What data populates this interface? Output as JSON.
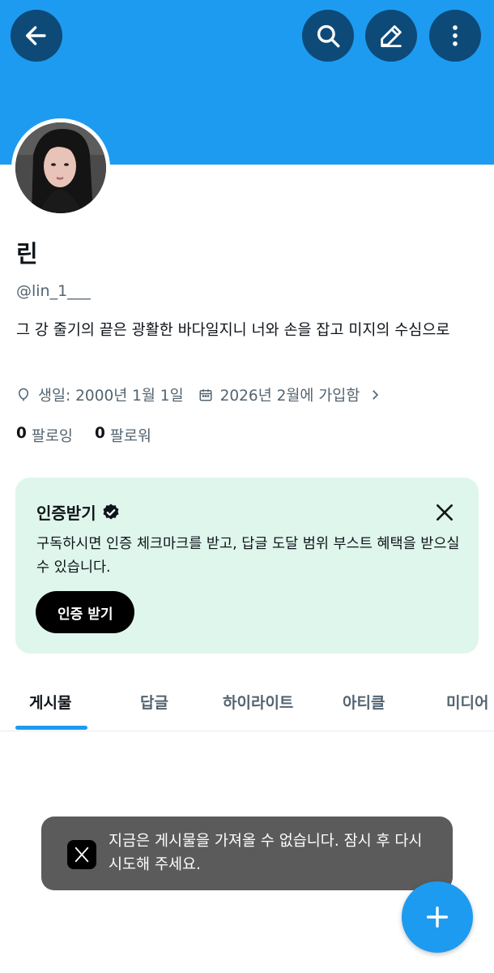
{
  "header": {
    "back_icon": "arrow-left-icon",
    "search_icon": "search-icon",
    "edit_icon": "pencil-icon",
    "more_icon": "more-vertical-icon",
    "banner_color": "#1d9bf0",
    "button_color": "#0d4a78"
  },
  "profile": {
    "name": "린",
    "handle": "@lin_1___",
    "bio": "그 강 줄기의 끝은 광활한 바다일지니 너와 손을 잡고 미지의 수심으로",
    "birthday": "생일: 2000년 1월 1일",
    "joined": "2026년 2월에 가입함",
    "following_count": "0",
    "following_label": "팔로잉",
    "followers_count": "0",
    "followers_label": "팔로워"
  },
  "verify_card": {
    "title": "인증받기",
    "description": "구독하시면 인증 체크마크를 받고, 답글 도달 범위 부스트 혜택을 받으실 수 있습니다.",
    "button_label": "인증 받기",
    "background": "#dff6ec"
  },
  "tabs": [
    {
      "label": "게시물",
      "active": true
    },
    {
      "label": "답글",
      "active": false
    },
    {
      "label": "하이라이트",
      "active": false
    },
    {
      "label": "아티클",
      "active": false
    },
    {
      "label": "미디어",
      "active": false
    }
  ],
  "toast": {
    "message": "지금은 게시물을 가져올 수 없습니다. 잠시 후 다시 시도해 주세요.",
    "icon": "x-logo-icon"
  },
  "fab": {
    "icon": "plus-icon",
    "color": "#1d9bf0"
  }
}
